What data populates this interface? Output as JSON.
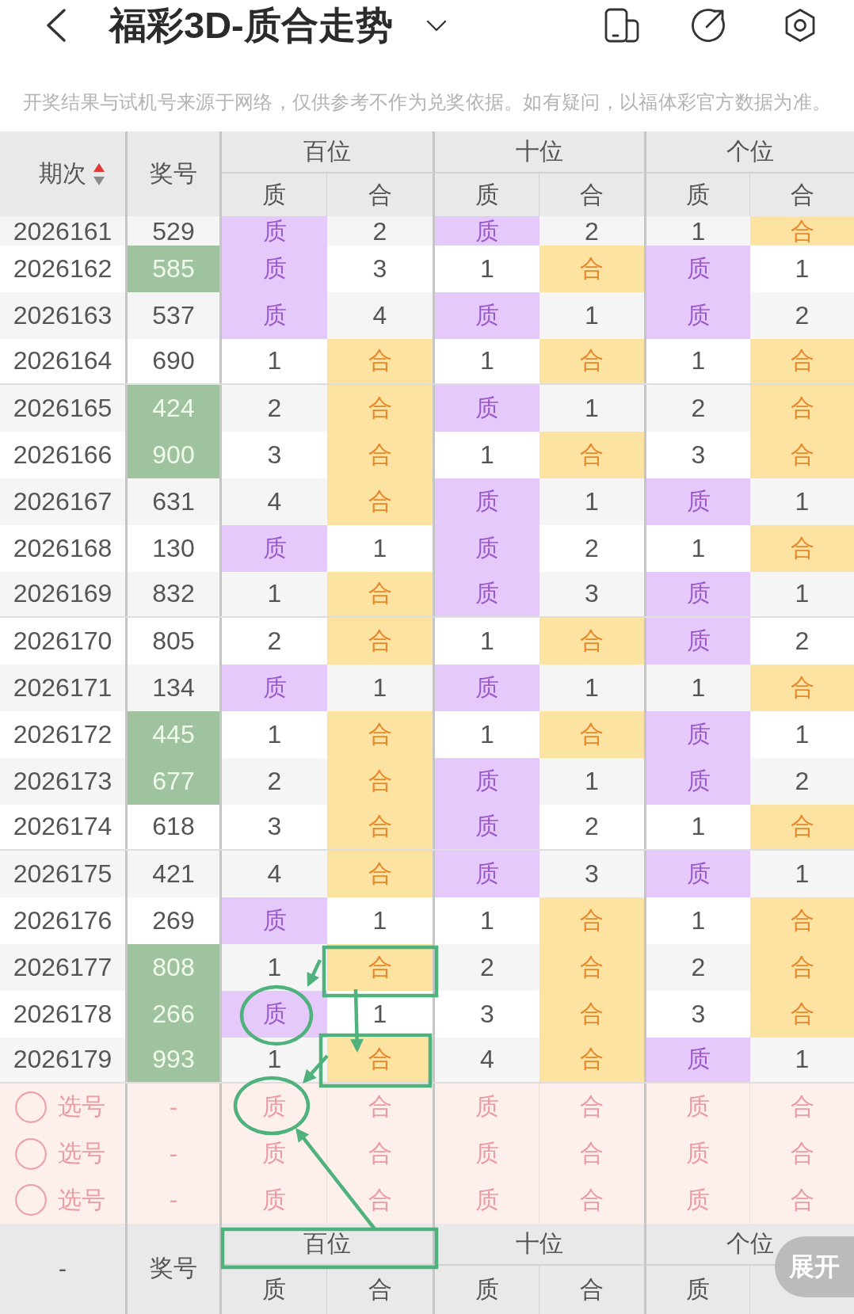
{
  "top_bar": {
    "title": "福彩3D-质合走势"
  },
  "notice": "开奖结果与试机号来源于网络，仅供参考不作为兑奖依据。如有疑问，以福体彩官方数据为准。",
  "table": {
    "header": {
      "period": "期次",
      "sort_ascending": true,
      "number": "奖号",
      "groups": [
        {
          "label": "百位",
          "sub": [
            "质",
            "合"
          ]
        },
        {
          "label": "十位",
          "sub": [
            "质",
            "合"
          ]
        },
        {
          "label": "个位",
          "sub": [
            "质",
            "合"
          ]
        }
      ]
    },
    "rows": [
      {
        "period": "2026161",
        "number": "529",
        "highlighted": false,
        "cells": [
          {
            "kind": "prime",
            "text": "质"
          },
          {
            "kind": "miss",
            "text": "2"
          },
          {
            "kind": "prime",
            "text": "质"
          },
          {
            "kind": "miss",
            "text": "2"
          },
          {
            "kind": "miss",
            "text": "1"
          },
          {
            "kind": "composite",
            "text": "合"
          }
        ]
      },
      {
        "period": "2026162",
        "number": "585",
        "highlighted": true,
        "cells": [
          {
            "kind": "prime",
            "text": "质"
          },
          {
            "kind": "miss",
            "text": "3"
          },
          {
            "kind": "miss",
            "text": "1"
          },
          {
            "kind": "composite",
            "text": "合"
          },
          {
            "kind": "prime",
            "text": "质"
          },
          {
            "kind": "miss",
            "text": "1"
          }
        ]
      },
      {
        "period": "2026163",
        "number": "537",
        "highlighted": false,
        "cells": [
          {
            "kind": "prime",
            "text": "质"
          },
          {
            "kind": "miss",
            "text": "4"
          },
          {
            "kind": "prime",
            "text": "质"
          },
          {
            "kind": "miss",
            "text": "1"
          },
          {
            "kind": "prime",
            "text": "质"
          },
          {
            "kind": "miss",
            "text": "2"
          }
        ]
      },
      {
        "period": "2026164",
        "number": "690",
        "highlighted": false,
        "cells": [
          {
            "kind": "miss",
            "text": "1"
          },
          {
            "kind": "composite",
            "text": "合"
          },
          {
            "kind": "miss",
            "text": "1"
          },
          {
            "kind": "composite",
            "text": "合"
          },
          {
            "kind": "miss",
            "text": "1"
          },
          {
            "kind": "composite",
            "text": "合"
          }
        ]
      },
      {
        "period": "2026165",
        "number": "424",
        "highlighted": true,
        "cells": [
          {
            "kind": "miss",
            "text": "2"
          },
          {
            "kind": "composite",
            "text": "合"
          },
          {
            "kind": "prime",
            "text": "质"
          },
          {
            "kind": "miss",
            "text": "1"
          },
          {
            "kind": "miss",
            "text": "2"
          },
          {
            "kind": "composite",
            "text": "合"
          }
        ]
      },
      {
        "period": "2026166",
        "number": "900",
        "highlighted": true,
        "cells": [
          {
            "kind": "miss",
            "text": "3"
          },
          {
            "kind": "composite",
            "text": "合"
          },
          {
            "kind": "miss",
            "text": "1"
          },
          {
            "kind": "composite",
            "text": "合"
          },
          {
            "kind": "miss",
            "text": "3"
          },
          {
            "kind": "composite",
            "text": "合"
          }
        ]
      },
      {
        "period": "2026167",
        "number": "631",
        "highlighted": false,
        "cells": [
          {
            "kind": "miss",
            "text": "4"
          },
          {
            "kind": "composite",
            "text": "合"
          },
          {
            "kind": "prime",
            "text": "质"
          },
          {
            "kind": "miss",
            "text": "1"
          },
          {
            "kind": "prime",
            "text": "质"
          },
          {
            "kind": "miss",
            "text": "1"
          }
        ]
      },
      {
        "period": "2026168",
        "number": "130",
        "highlighted": false,
        "cells": [
          {
            "kind": "prime",
            "text": "质"
          },
          {
            "kind": "miss",
            "text": "1"
          },
          {
            "kind": "prime",
            "text": "质"
          },
          {
            "kind": "miss",
            "text": "2"
          },
          {
            "kind": "miss",
            "text": "1"
          },
          {
            "kind": "composite",
            "text": "合"
          }
        ]
      },
      {
        "period": "2026169",
        "number": "832",
        "highlighted": false,
        "cells": [
          {
            "kind": "miss",
            "text": "1"
          },
          {
            "kind": "composite",
            "text": "合"
          },
          {
            "kind": "prime",
            "text": "质"
          },
          {
            "kind": "miss",
            "text": "3"
          },
          {
            "kind": "prime",
            "text": "质"
          },
          {
            "kind": "miss",
            "text": "1"
          }
        ]
      },
      {
        "period": "2026170",
        "number": "805",
        "highlighted": false,
        "cells": [
          {
            "kind": "miss",
            "text": "2"
          },
          {
            "kind": "composite",
            "text": "合"
          },
          {
            "kind": "miss",
            "text": "1"
          },
          {
            "kind": "composite",
            "text": "合"
          },
          {
            "kind": "prime",
            "text": "质"
          },
          {
            "kind": "miss",
            "text": "2"
          }
        ]
      },
      {
        "period": "2026171",
        "number": "134",
        "highlighted": false,
        "cells": [
          {
            "kind": "prime",
            "text": "质"
          },
          {
            "kind": "miss",
            "text": "1"
          },
          {
            "kind": "prime",
            "text": "质"
          },
          {
            "kind": "miss",
            "text": "1"
          },
          {
            "kind": "miss",
            "text": "1"
          },
          {
            "kind": "composite",
            "text": "合"
          }
        ]
      },
      {
        "period": "2026172",
        "number": "445",
        "highlighted": true,
        "cells": [
          {
            "kind": "miss",
            "text": "1"
          },
          {
            "kind": "composite",
            "text": "合"
          },
          {
            "kind": "miss",
            "text": "1"
          },
          {
            "kind": "composite",
            "text": "合"
          },
          {
            "kind": "prime",
            "text": "质"
          },
          {
            "kind": "miss",
            "text": "1"
          }
        ]
      },
      {
        "period": "2026173",
        "number": "677",
        "highlighted": true,
        "cells": [
          {
            "kind": "miss",
            "text": "2"
          },
          {
            "kind": "composite",
            "text": "合"
          },
          {
            "kind": "prime",
            "text": "质"
          },
          {
            "kind": "miss",
            "text": "1"
          },
          {
            "kind": "prime",
            "text": "质"
          },
          {
            "kind": "miss",
            "text": "2"
          }
        ]
      },
      {
        "period": "2026174",
        "number": "618",
        "highlighted": false,
        "cells": [
          {
            "kind": "miss",
            "text": "3"
          },
          {
            "kind": "composite",
            "text": "合"
          },
          {
            "kind": "prime",
            "text": "质"
          },
          {
            "kind": "miss",
            "text": "2"
          },
          {
            "kind": "miss",
            "text": "1"
          },
          {
            "kind": "composite",
            "text": "合"
          }
        ]
      },
      {
        "period": "2026175",
        "number": "421",
        "highlighted": false,
        "cells": [
          {
            "kind": "miss",
            "text": "4"
          },
          {
            "kind": "composite",
            "text": "合"
          },
          {
            "kind": "prime",
            "text": "质"
          },
          {
            "kind": "miss",
            "text": "3"
          },
          {
            "kind": "prime",
            "text": "质"
          },
          {
            "kind": "miss",
            "text": "1"
          }
        ]
      },
      {
        "period": "2026176",
        "number": "269",
        "highlighted": false,
        "cells": [
          {
            "kind": "prime",
            "text": "质"
          },
          {
            "kind": "miss",
            "text": "1"
          },
          {
            "kind": "miss",
            "text": "1"
          },
          {
            "kind": "composite",
            "text": "合"
          },
          {
            "kind": "miss",
            "text": "1"
          },
          {
            "kind": "composite",
            "text": "合"
          }
        ]
      },
      {
        "period": "2026177",
        "number": "808",
        "highlighted": true,
        "cells": [
          {
            "kind": "miss",
            "text": "1"
          },
          {
            "kind": "composite",
            "text": "合"
          },
          {
            "kind": "miss",
            "text": "2"
          },
          {
            "kind": "composite",
            "text": "合"
          },
          {
            "kind": "miss",
            "text": "2"
          },
          {
            "kind": "composite",
            "text": "合"
          }
        ]
      },
      {
        "period": "2026178",
        "number": "266",
        "highlighted": true,
        "cells": [
          {
            "kind": "prime",
            "text": "质"
          },
          {
            "kind": "miss",
            "text": "1"
          },
          {
            "kind": "miss",
            "text": "3"
          },
          {
            "kind": "composite",
            "text": "合"
          },
          {
            "kind": "miss",
            "text": "3"
          },
          {
            "kind": "composite",
            "text": "合"
          }
        ]
      },
      {
        "period": "2026179",
        "number": "993",
        "highlighted": true,
        "cells": [
          {
            "kind": "miss",
            "text": "1"
          },
          {
            "kind": "composite",
            "text": "合"
          },
          {
            "kind": "miss",
            "text": "4"
          },
          {
            "kind": "composite",
            "text": "合"
          },
          {
            "kind": "prime",
            "text": "质"
          },
          {
            "kind": "miss",
            "text": "1"
          }
        ]
      }
    ],
    "pick_rows": [
      {
        "label": "选号",
        "selected": false,
        "number": "-",
        "options": [
          {
            "label": "质",
            "selected": false
          },
          {
            "label": "合",
            "selected": false
          },
          {
            "label": "质",
            "selected": false
          },
          {
            "label": "合",
            "selected": false
          },
          {
            "label": "质",
            "selected": false
          },
          {
            "label": "合",
            "selected": false
          }
        ]
      },
      {
        "label": "选号",
        "selected": false,
        "number": "-",
        "options": [
          {
            "label": "质",
            "selected": false
          },
          {
            "label": "合",
            "selected": false
          },
          {
            "label": "质",
            "selected": false
          },
          {
            "label": "合",
            "selected": false
          },
          {
            "label": "质",
            "selected": false
          },
          {
            "label": "合",
            "selected": false
          }
        ]
      },
      {
        "label": "选号",
        "selected": false,
        "number": "-",
        "options": [
          {
            "label": "质",
            "selected": false
          },
          {
            "label": "合",
            "selected": false
          },
          {
            "label": "质",
            "selected": false
          },
          {
            "label": "合",
            "selected": false
          },
          {
            "label": "质",
            "selected": false
          },
          {
            "label": "合",
            "selected": false
          }
        ]
      }
    ],
    "footer": {
      "period": "-",
      "number": "奖号",
      "groups": [
        {
          "label": "百位",
          "sub": [
            "质",
            "合"
          ]
        },
        {
          "label": "十位",
          "sub": [
            "质",
            "合"
          ]
        },
        {
          "label": "个位",
          "sub": [
            "质"
          ]
        }
      ]
    }
  },
  "expand_button": "展开"
}
